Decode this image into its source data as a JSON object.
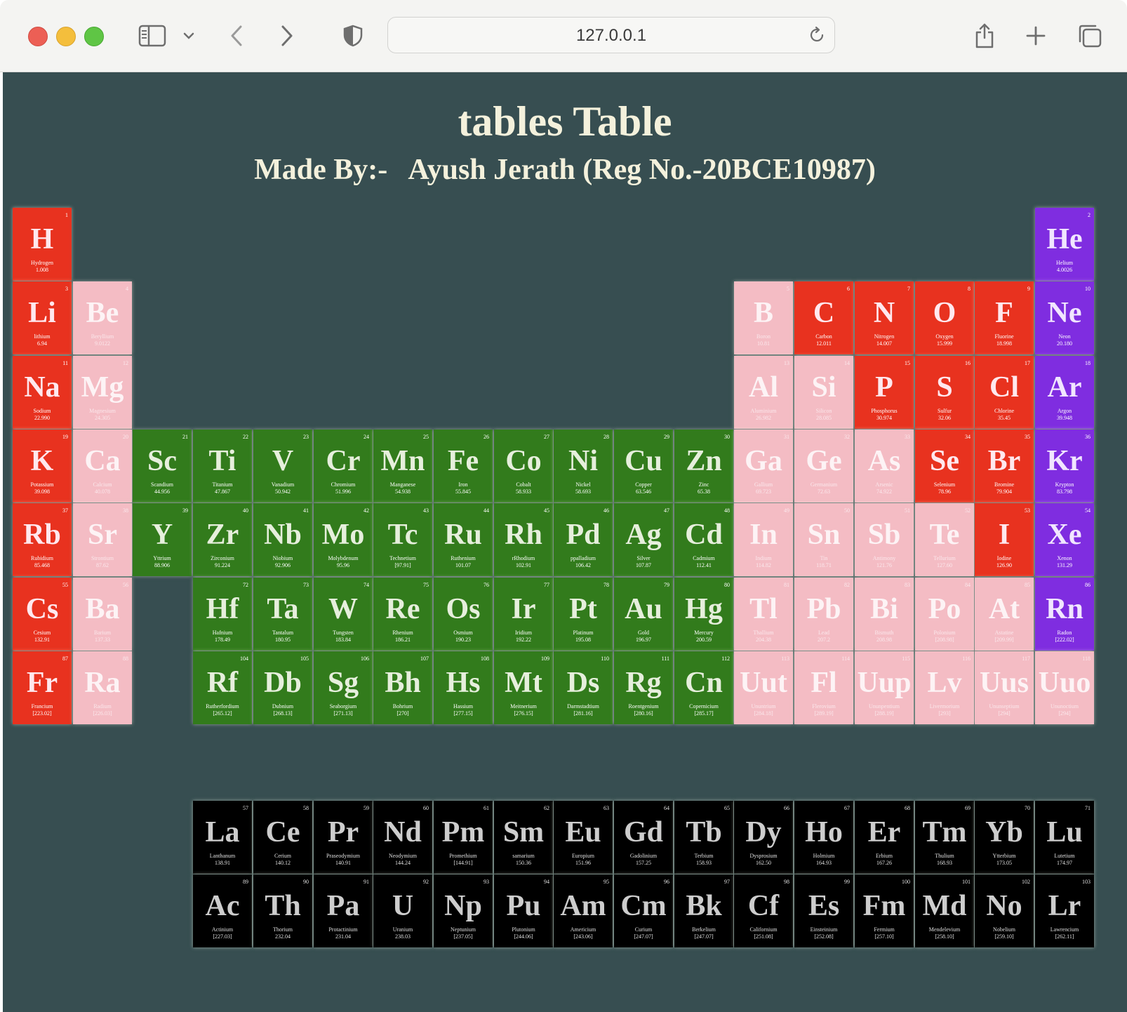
{
  "browser": {
    "url": "127.0.0.1"
  },
  "page": {
    "title": "tables Table",
    "subtitle": "Made By:-   Ayush Jerath (Reg No.-20BCE10987)"
  },
  "colors": {
    "background": "#374e51",
    "red": "#e8321f",
    "pink": "#f4bcc4",
    "purple": "#7f2de0",
    "green": "#327b1c",
    "black": "#000000"
  },
  "elements": [
    {
      "n": "1",
      "s": "H",
      "name": "Hydrogen",
      "m": "1.008",
      "c": "red",
      "r": 1,
      "col": 1
    },
    {
      "n": "2",
      "s": "He",
      "name": "Helium",
      "m": "4.0026",
      "c": "purple",
      "r": 1,
      "col": 18
    },
    {
      "n": "3",
      "s": "Li",
      "name": "lithium",
      "m": "6.94",
      "c": "red",
      "r": 2,
      "col": 1
    },
    {
      "n": "4",
      "s": "Be",
      "name": "Beryllium",
      "m": "9.0122",
      "c": "pink",
      "r": 2,
      "col": 2
    },
    {
      "n": "5",
      "s": "B",
      "name": "Boron",
      "m": "10.81",
      "c": "pink",
      "r": 2,
      "col": 13
    },
    {
      "n": "6",
      "s": "C",
      "name": "Carbon",
      "m": "12.011",
      "c": "red",
      "r": 2,
      "col": 14
    },
    {
      "n": "7",
      "s": "N",
      "name": "Nitrogen",
      "m": "14.007",
      "c": "red",
      "r": 2,
      "col": 15
    },
    {
      "n": "8",
      "s": "O",
      "name": "Oxygen",
      "m": "15.999",
      "c": "red",
      "r": 2,
      "col": 16
    },
    {
      "n": "9",
      "s": "F",
      "name": "Fluorine",
      "m": "18.998",
      "c": "red",
      "r": 2,
      "col": 17
    },
    {
      "n": "10",
      "s": "Ne",
      "name": "Neon",
      "m": "20.180",
      "c": "purple",
      "r": 2,
      "col": 18
    },
    {
      "n": "11",
      "s": "Na",
      "name": "Sodium",
      "m": "22.990",
      "c": "red",
      "r": 3,
      "col": 1
    },
    {
      "n": "12",
      "s": "Mg",
      "name": "Magnesium",
      "m": "24.305",
      "c": "pink",
      "r": 3,
      "col": 2
    },
    {
      "n": "13",
      "s": "Al",
      "name": "Aluminium",
      "m": "26.982",
      "c": "pink",
      "r": 3,
      "col": 13
    },
    {
      "n": "14",
      "s": "Si",
      "name": "Silicon",
      "m": "28.085",
      "c": "pink",
      "r": 3,
      "col": 14
    },
    {
      "n": "15",
      "s": "P",
      "name": "Phosphorus",
      "m": "30.974",
      "c": "red",
      "r": 3,
      "col": 15
    },
    {
      "n": "16",
      "s": "S",
      "name": "Sulfur",
      "m": "32.06",
      "c": "red",
      "r": 3,
      "col": 16
    },
    {
      "n": "17",
      "s": "Cl",
      "name": "Chlorine",
      "m": "35.45",
      "c": "red",
      "r": 3,
      "col": 17
    },
    {
      "n": "18",
      "s": "Ar",
      "name": "Argon",
      "m": "39.948",
      "c": "purple",
      "r": 3,
      "col": 18
    },
    {
      "n": "19",
      "s": "K",
      "name": "Potassium",
      "m": "39.098",
      "c": "red",
      "r": 4,
      "col": 1
    },
    {
      "n": "20",
      "s": "Ca",
      "name": "Calcium",
      "m": "40.078",
      "c": "pink",
      "r": 4,
      "col": 2
    },
    {
      "n": "21",
      "s": "Sc",
      "name": "Scandium",
      "m": "44.956",
      "c": "green",
      "r": 4,
      "col": 3
    },
    {
      "n": "22",
      "s": "Ti",
      "name": "Titanium",
      "m": "47.867",
      "c": "green",
      "r": 4,
      "col": 4
    },
    {
      "n": "23",
      "s": "V",
      "name": "Vanadium",
      "m": "50.942",
      "c": "green",
      "r": 4,
      "col": 5
    },
    {
      "n": "24",
      "s": "Cr",
      "name": "Chromium",
      "m": "51.996",
      "c": "green",
      "r": 4,
      "col": 6
    },
    {
      "n": "25",
      "s": "Mn",
      "name": "Manganese",
      "m": "54.938",
      "c": "green",
      "r": 4,
      "col": 7
    },
    {
      "n": "26",
      "s": "Fe",
      "name": "Iron",
      "m": "55.845",
      "c": "green",
      "r": 4,
      "col": 8
    },
    {
      "n": "27",
      "s": "Co",
      "name": "Cobalt",
      "m": "58.933",
      "c": "green",
      "r": 4,
      "col": 9
    },
    {
      "n": "28",
      "s": "Ni",
      "name": "Nickel",
      "m": "58.693",
      "c": "green",
      "r": 4,
      "col": 10
    },
    {
      "n": "29",
      "s": "Cu",
      "name": "Copper",
      "m": "63.546",
      "c": "green",
      "r": 4,
      "col": 11
    },
    {
      "n": "30",
      "s": "Zn",
      "name": "Zinc",
      "m": "65.38",
      "c": "green",
      "r": 4,
      "col": 12
    },
    {
      "n": "31",
      "s": "Ga",
      "name": "Gallium",
      "m": "69.723",
      "c": "pink",
      "r": 4,
      "col": 13
    },
    {
      "n": "32",
      "s": "Ge",
      "name": "Germanium",
      "m": "72.63",
      "c": "pink",
      "r": 4,
      "col": 14
    },
    {
      "n": "33",
      "s": "As",
      "name": "Arsenic",
      "m": "74.922",
      "c": "pink",
      "r": 4,
      "col": 15
    },
    {
      "n": "34",
      "s": "Se",
      "name": "Selenium",
      "m": "78.96",
      "c": "red",
      "r": 4,
      "col": 16
    },
    {
      "n": "35",
      "s": "Br",
      "name": "Bromine",
      "m": "79.904",
      "c": "red",
      "r": 4,
      "col": 17
    },
    {
      "n": "36",
      "s": "Kr",
      "name": "Krypton",
      "m": "83.798",
      "c": "purple",
      "r": 4,
      "col": 18
    },
    {
      "n": "37",
      "s": "Rb",
      "name": "Rubidium",
      "m": "85.468",
      "c": "red",
      "r": 5,
      "col": 1
    },
    {
      "n": "38",
      "s": "Sr",
      "name": "Strontium",
      "m": "87.62",
      "c": "pink",
      "r": 5,
      "col": 2
    },
    {
      "n": "39",
      "s": "Y",
      "name": "Yttrium",
      "m": "88.906",
      "c": "green",
      "r": 5,
      "col": 3
    },
    {
      "n": "40",
      "s": "Zr",
      "name": "Zirconium",
      "m": "91.224",
      "c": "green",
      "r": 5,
      "col": 4
    },
    {
      "n": "41",
      "s": "Nb",
      "name": "Niobium",
      "m": "92.906",
      "c": "green",
      "r": 5,
      "col": 5
    },
    {
      "n": "42",
      "s": "Mo",
      "name": "Molybdenum",
      "m": "95.96",
      "c": "green",
      "r": 5,
      "col": 6
    },
    {
      "n": "43",
      "s": "Tc",
      "name": "Technetium",
      "m": "[97.91]",
      "c": "green",
      "r": 5,
      "col": 7
    },
    {
      "n": "44",
      "s": "Ru",
      "name": "Ruthenium",
      "m": "101.07",
      "c": "green",
      "r": 5,
      "col": 8
    },
    {
      "n": "45",
      "s": "Rh",
      "name": "rRhodium",
      "m": "102.91",
      "c": "green",
      "r": 5,
      "col": 9
    },
    {
      "n": "46",
      "s": "Pd",
      "name": "ppalladium",
      "m": "106.42",
      "c": "green",
      "r": 5,
      "col": 10
    },
    {
      "n": "47",
      "s": "Ag",
      "name": "Silver",
      "m": "107.87",
      "c": "green",
      "r": 5,
      "col": 11
    },
    {
      "n": "48",
      "s": "Cd",
      "name": "Cadmium",
      "m": "112.41",
      "c": "green",
      "r": 5,
      "col": 12
    },
    {
      "n": "49",
      "s": "In",
      "name": "Indium",
      "m": "114.82",
      "c": "pink",
      "r": 5,
      "col": 13
    },
    {
      "n": "50",
      "s": "Sn",
      "name": "Tin",
      "m": "118.71",
      "c": "pink",
      "r": 5,
      "col": 14
    },
    {
      "n": "51",
      "s": "Sb",
      "name": "Antimony",
      "m": "121.76",
      "c": "pink",
      "r": 5,
      "col": 15
    },
    {
      "n": "52",
      "s": "Te",
      "name": "Tellurium",
      "m": "127.60",
      "c": "pink",
      "r": 5,
      "col": 16
    },
    {
      "n": "53",
      "s": "I",
      "name": "Iodine",
      "m": "126.90",
      "c": "red",
      "r": 5,
      "col": 17
    },
    {
      "n": "54",
      "s": "Xe",
      "name": "Xenon",
      "m": "131.29",
      "c": "purple",
      "r": 5,
      "col": 18
    },
    {
      "n": "55",
      "s": "Cs",
      "name": "Cesium",
      "m": "132.91",
      "c": "red",
      "r": 6,
      "col": 1
    },
    {
      "n": "56",
      "s": "Ba",
      "name": "Barium",
      "m": "137.33",
      "c": "pink",
      "r": 6,
      "col": 2
    },
    {
      "n": "72",
      "s": "Hf",
      "name": "Hafnium",
      "m": "178.49",
      "c": "green",
      "r": 6,
      "col": 4
    },
    {
      "n": "73",
      "s": "Ta",
      "name": "Tantalum",
      "m": "180.95",
      "c": "green",
      "r": 6,
      "col": 5
    },
    {
      "n": "74",
      "s": "W",
      "name": "Tungsten",
      "m": "183.84",
      "c": "green",
      "r": 6,
      "col": 6
    },
    {
      "n": "75",
      "s": "Re",
      "name": "Rhenium",
      "m": "186.21",
      "c": "green",
      "r": 6,
      "col": 7
    },
    {
      "n": "76",
      "s": "Os",
      "name": "Osmium",
      "m": "190.23",
      "c": "green",
      "r": 6,
      "col": 8
    },
    {
      "n": "77",
      "s": "Ir",
      "name": "Iridium",
      "m": "192.22",
      "c": "green",
      "r": 6,
      "col": 9
    },
    {
      "n": "78",
      "s": "Pt",
      "name": "Platinum",
      "m": "195.08",
      "c": "green",
      "r": 6,
      "col": 10
    },
    {
      "n": "79",
      "s": "Au",
      "name": "Gold",
      "m": "196.97",
      "c": "green",
      "r": 6,
      "col": 11
    },
    {
      "n": "80",
      "s": "Hg",
      "name": "Mercury",
      "m": "200.59",
      "c": "green",
      "r": 6,
      "col": 12
    },
    {
      "n": "81",
      "s": "Tl",
      "name": "Thallium",
      "m": "204.38",
      "c": "pink",
      "r": 6,
      "col": 13
    },
    {
      "n": "82",
      "s": "Pb",
      "name": "Lead",
      "m": "207.2",
      "c": "pink",
      "r": 6,
      "col": 14
    },
    {
      "n": "83",
      "s": "Bi",
      "name": "Bismuth",
      "m": "208.98",
      "c": "pink",
      "r": 6,
      "col": 15
    },
    {
      "n": "84",
      "s": "Po",
      "name": "Polonium",
      "m": "[208.98]",
      "c": "pink",
      "r": 6,
      "col": 16
    },
    {
      "n": "85",
      "s": "At",
      "name": "Astatine",
      "m": "[209.99]",
      "c": "pink",
      "r": 6,
      "col": 17
    },
    {
      "n": "86",
      "s": "Rn",
      "name": "Radon",
      "m": "[222.02]",
      "c": "purple",
      "r": 6,
      "col": 18
    },
    {
      "n": "87",
      "s": "Fr",
      "name": "Francium",
      "m": "[223.02]",
      "c": "red",
      "r": 7,
      "col": 1
    },
    {
      "n": "88",
      "s": "Ra",
      "name": "Radium",
      "m": "[226.03]",
      "c": "pink",
      "r": 7,
      "col": 2
    },
    {
      "n": "104",
      "s": "Rf",
      "name": "Rutherfordium",
      "m": "[265.12]",
      "c": "green",
      "r": 7,
      "col": 4
    },
    {
      "n": "105",
      "s": "Db",
      "name": "Dubnium",
      "m": "[268.13]",
      "c": "green",
      "r": 7,
      "col": 5
    },
    {
      "n": "106",
      "s": "Sg",
      "name": "Seaborgium",
      "m": "[271.13]",
      "c": "green",
      "r": 7,
      "col": 6
    },
    {
      "n": "107",
      "s": "Bh",
      "name": "Bohrium",
      "m": "[270]",
      "c": "green",
      "r": 7,
      "col": 7
    },
    {
      "n": "108",
      "s": "Hs",
      "name": "Hassium",
      "m": "[277.15]",
      "c": "green",
      "r": 7,
      "col": 8
    },
    {
      "n": "109",
      "s": "Mt",
      "name": "Meitnerium",
      "m": "[276.15]",
      "c": "green",
      "r": 7,
      "col": 9
    },
    {
      "n": "110",
      "s": "Ds",
      "name": "Darmstadtium",
      "m": "[281.16]",
      "c": "green",
      "r": 7,
      "col": 10
    },
    {
      "n": "111",
      "s": "Rg",
      "name": "Roentgenium",
      "m": "[280.16]",
      "c": "green",
      "r": 7,
      "col": 11
    },
    {
      "n": "112",
      "s": "Cn",
      "name": "Copernicium",
      "m": "[285.17]",
      "c": "green",
      "r": 7,
      "col": 12
    },
    {
      "n": "113",
      "s": "Uut",
      "name": "Ununtrium",
      "m": "[284.18]",
      "c": "pink",
      "r": 7,
      "col": 13
    },
    {
      "n": "114",
      "s": "Fl",
      "name": "Flerovium",
      "m": "[289.19]",
      "c": "pink",
      "r": 7,
      "col": 14
    },
    {
      "n": "115",
      "s": "Uup",
      "name": "Ununpentium",
      "m": "[288.19]",
      "c": "pink",
      "r": 7,
      "col": 15
    },
    {
      "n": "116",
      "s": "Lv",
      "name": "Livermorium",
      "m": "[293]",
      "c": "pink",
      "r": 7,
      "col": 16
    },
    {
      "n": "117",
      "s": "Uus",
      "name": "Ununseptium",
      "m": "[294]",
      "c": "pink",
      "r": 7,
      "col": 17
    },
    {
      "n": "118",
      "s": "Uuo",
      "name": "Ununoctium",
      "m": "[294]",
      "c": "pink",
      "r": 7,
      "col": 18
    },
    {
      "n": "57",
      "s": "La",
      "name": "Lanthanum",
      "m": "138.91",
      "c": "black",
      "r": 9,
      "col": 4
    },
    {
      "n": "58",
      "s": "Ce",
      "name": "Cerium",
      "m": "140.12",
      "c": "black",
      "r": 9,
      "col": 5
    },
    {
      "n": "59",
      "s": "Pr",
      "name": "Praseodymium",
      "m": "140.91",
      "c": "black",
      "r": 9,
      "col": 6
    },
    {
      "n": "60",
      "s": "Nd",
      "name": "Neodymium",
      "m": "144.24",
      "c": "black",
      "r": 9,
      "col": 7
    },
    {
      "n": "61",
      "s": "Pm",
      "name": "Promethium",
      "m": "[144.91]",
      "c": "black",
      "r": 9,
      "col": 8
    },
    {
      "n": "62",
      "s": "Sm",
      "name": "samarium",
      "m": "150.36",
      "c": "black",
      "r": 9,
      "col": 9
    },
    {
      "n": "63",
      "s": "Eu",
      "name": "Europium",
      "m": "151.96",
      "c": "black",
      "r": 9,
      "col": 10
    },
    {
      "n": "64",
      "s": "Gd",
      "name": "Gadolinium",
      "m": "157.25",
      "c": "black",
      "r": 9,
      "col": 11
    },
    {
      "n": "65",
      "s": "Tb",
      "name": "Terbium",
      "m": "158.93",
      "c": "black",
      "r": 9,
      "col": 12
    },
    {
      "n": "66",
      "s": "Dy",
      "name": "Dysprosium",
      "m": "162.50",
      "c": "black",
      "r": 9,
      "col": 13
    },
    {
      "n": "67",
      "s": "Ho",
      "name": "Holmium",
      "m": "164.93",
      "c": "black",
      "r": 9,
      "col": 14
    },
    {
      "n": "68",
      "s": "Er",
      "name": "Erbium",
      "m": "167.26",
      "c": "black",
      "r": 9,
      "col": 15
    },
    {
      "n": "69",
      "s": "Tm",
      "name": "Thulium",
      "m": "168.93",
      "c": "black",
      "r": 9,
      "col": 16
    },
    {
      "n": "70",
      "s": "Yb",
      "name": "Ytterbium",
      "m": "173.05",
      "c": "black",
      "r": 9,
      "col": 17
    },
    {
      "n": "71",
      "s": "Lu",
      "name": "Lutetium",
      "m": "174.97",
      "c": "black",
      "r": 9,
      "col": 18
    },
    {
      "n": "89",
      "s": "Ac",
      "name": "Actinium",
      "m": "[227.03]",
      "c": "black",
      "r": 10,
      "col": 4
    },
    {
      "n": "90",
      "s": "Th",
      "name": "Thorium",
      "m": "232.04",
      "c": "black",
      "r": 10,
      "col": 5
    },
    {
      "n": "91",
      "s": "Pa",
      "name": "Protactinium",
      "m": "231.04",
      "c": "black",
      "r": 10,
      "col": 6
    },
    {
      "n": "92",
      "s": "U",
      "name": "Uranium",
      "m": "238.03",
      "c": "black",
      "r": 10,
      "col": 7
    },
    {
      "n": "93",
      "s": "Np",
      "name": "Neptunium",
      "m": "[237.05]",
      "c": "black",
      "r": 10,
      "col": 8
    },
    {
      "n": "94",
      "s": "Pu",
      "name": "Plutonium",
      "m": "[244.06]",
      "c": "black",
      "r": 10,
      "col": 9
    },
    {
      "n": "95",
      "s": "Am",
      "name": "Americium",
      "m": "[243.06]",
      "c": "black",
      "r": 10,
      "col": 10
    },
    {
      "n": "96",
      "s": "Cm",
      "name": "Curium",
      "m": "[247.07]",
      "c": "black",
      "r": 10,
      "col": 11
    },
    {
      "n": "97",
      "s": "Bk",
      "name": "Berkelium",
      "m": "[247.07]",
      "c": "black",
      "r": 10,
      "col": 12
    },
    {
      "n": "98",
      "s": "Cf",
      "name": "Californium",
      "m": "[251.08]",
      "c": "black",
      "r": 10,
      "col": 13
    },
    {
      "n": "99",
      "s": "Es",
      "name": "Einsteinium",
      "m": "[252.08]",
      "c": "black",
      "r": 10,
      "col": 14
    },
    {
      "n": "100",
      "s": "Fm",
      "name": "Fermium",
      "m": "[257.10]",
      "c": "black",
      "r": 10,
      "col": 15
    },
    {
      "n": "101",
      "s": "Md",
      "name": "Mendelevium",
      "m": "[258.10]",
      "c": "black",
      "r": 10,
      "col": 16
    },
    {
      "n": "102",
      "s": "No",
      "name": "Nobelium",
      "m": "[259.10]",
      "c": "black",
      "r": 10,
      "col": 17
    },
    {
      "n": "103",
      "s": "Lr",
      "name": "Lawrencium",
      "m": "[262.11]",
      "c": "black",
      "r": 10,
      "col": 18
    }
  ]
}
